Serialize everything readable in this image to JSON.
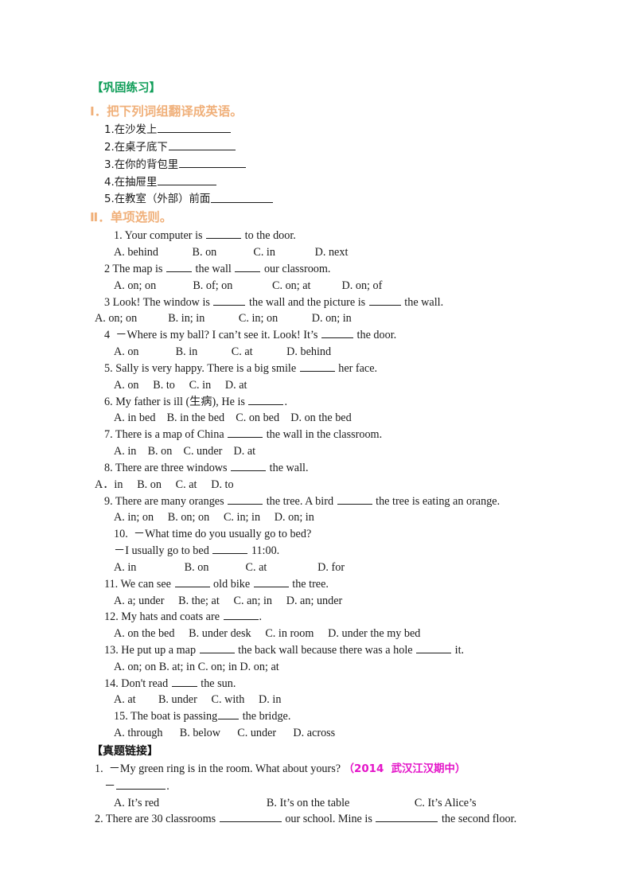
{
  "document": {
    "headings": {
      "consolidation": "【巩固练习】",
      "section_1": "Ⅰ．把下列词组翻译成英语。",
      "section_2": "Ⅱ．单项选则。",
      "real_questions": "【真题链接】"
    },
    "colors": {
      "green_heading": "#0f9d58",
      "orange_heading": "#f0b07a",
      "black_heading": "#111111",
      "magenta_note": "#e414c8",
      "body_text": "#1a1a1a",
      "background": "#ffffff"
    },
    "translation_items": [
      {
        "num": "1.",
        "text": "在沙发上",
        "blank_width": 92
      },
      {
        "num": "2.",
        "text": "在桌子底下",
        "blank_width": 84
      },
      {
        "num": "3.",
        "text": "在你的背包里",
        "blank_width": 84
      },
      {
        "num": "4.",
        "text": "在抽屉里",
        "blank_width": 74
      },
      {
        "num": "5.",
        "text": "在教室（外部）前面",
        "blank_width": 78
      }
    ],
    "multiple_choice": [
      {
        "stem_a": "1. Your computer is ",
        "blank1": 44,
        "stem_b": " to the door.",
        "options": "A. behind            B. on             C. in              D. next"
      },
      {
        "stem_a": "2 The map is ",
        "blank1": 32,
        "stem_b": " the wall ",
        "blank2": 32,
        "stem_c": " our classroom.",
        "options": "A. on; on             B. of; on              C. on; at           D. on; of"
      },
      {
        "stem_a": "3 Look! The window is ",
        "blank1": 40,
        "stem_b": " the wall and the picture is ",
        "blank2": 40,
        "stem_c": " the wall.",
        "options": "A. on; on           B. in; in            C. in; on            D. on; in"
      },
      {
        "stem_a": "4  －Where is my ball? I can’t see it. Look! It’s ",
        "blank1": 40,
        "stem_b": " the door.",
        "options": "A. on             B. in            C. at            D. behind"
      },
      {
        "stem_a": "5. Sally is very happy. There is a big smile ",
        "blank1": 44,
        "stem_b": " her face.",
        "options": "A. on     B. to     C. in     D. at"
      },
      {
        "stem_a": "6. My father is ill (生病), He is ",
        "blank1": 44,
        "stem_b": ".",
        "options": "A. in bed    B. in the bed    C. on bed    D. on the bed"
      },
      {
        "stem_a": "7. There is a map of China ",
        "blank1": 44,
        "stem_b": " the wall in the classroom.",
        "options": "A. in    B. on    C. under    D. at"
      },
      {
        "stem_a": "8. There are three windows ",
        "blank1": 44,
        "stem_b": " the wall.",
        "options": "A．in     B. on     C. at     D. to",
        "options_indent": 0
      },
      {
        "stem_a": "9. There are many oranges ",
        "blank1": 44,
        "stem_b": " the tree. A bird ",
        "blank2": 44,
        "stem_c": " the tree is eating an orange.",
        "options": "A. in; on     B. on; on     C. in; in     D. on; in"
      },
      {
        "stem_a": "10.  －What time do you usually go to bed?",
        "stem_line2_a": "－I usually go to bed ",
        "blank1": 44,
        "stem_line2_b": " 11:00.",
        "options": "A. in                 B. on             C. at                  D. for"
      },
      {
        "stem_a": "11. We can see ",
        "blank1": 44,
        "stem_b": " old bike ",
        "blank2": 44,
        "stem_c": " the tree.",
        "options": "A. a; under     B. the; at     C. an; in     D. an; under"
      },
      {
        "stem_a": "12. My hats and coats are ",
        "blank1": 44,
        "stem_b": ".",
        "options": "A. on the bed     B. under desk     C. in room     D. under the my bed"
      },
      {
        "stem_a": "13. He put up a map ",
        "blank1": 44,
        "stem_b": " the back wall because there was a hole ",
        "blank2": 44,
        "stem_c": " it.",
        "options": "A. on; on B. at; in C. on; in D. on; at"
      },
      {
        "stem_a": "14. Don't read ",
        "blank1": 32,
        "stem_b": " the sun.",
        "options": "A. at        B. under     C. with     D. in"
      },
      {
        "stem_a": "15. The boat is passing",
        "blank1": 26,
        "stem_b": " the bridge.",
        "options": "A. through      B. below      C. under      D. across"
      }
    ],
    "real_questions": [
      {
        "stem": "1.  －My green ring is in the room. What about yours?",
        "source_note": "（2014  武汉江汉期中）",
        "answer_line_prefix": "－",
        "answer_blank": 62,
        "answer_line_suffix": ".",
        "options": "A. It’s red                                      B. It’s on the table                       C. It’s Alice’s"
      },
      {
        "stem_a": "2. There are 30 classrooms ",
        "blank1": 78,
        "stem_b": " our school. Mine is ",
        "blank2": 78,
        "stem_c": " the second floor."
      }
    ]
  }
}
